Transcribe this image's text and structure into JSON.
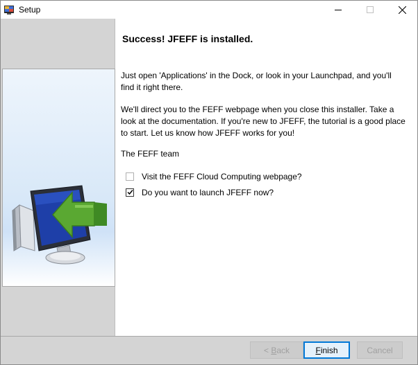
{
  "window": {
    "title": "Setup"
  },
  "content": {
    "heading": "Success!  JFEFF is installed.",
    "paragraph1": "Just open 'Applications' in the Dock, or look in your Launchpad, and you'll find it right there.",
    "paragraph2": "We'll direct you to the FEFF webpage when you close this installer.  Take a look at the documentation.  If you're new to JFEFF, the tutorial is a good place to start.  Let us know how JFEFF works for you!",
    "paragraph3": "The FEFF team",
    "options": [
      {
        "label": "Visit the FEFF Cloud Computing webpage?",
        "checked": false
      },
      {
        "label": "Do you want to launch JFEFF now?",
        "checked": true
      }
    ]
  },
  "buttons": {
    "back_prefix": "< ",
    "back_accel": "B",
    "back_rest": "ack",
    "finish_accel": "F",
    "finish_rest": "inish",
    "cancel_label": "Cancel"
  },
  "colors": {
    "accent": "#0078d7",
    "arrow_green": "#5aa832",
    "monitor_blue": "#1e3fa8"
  }
}
